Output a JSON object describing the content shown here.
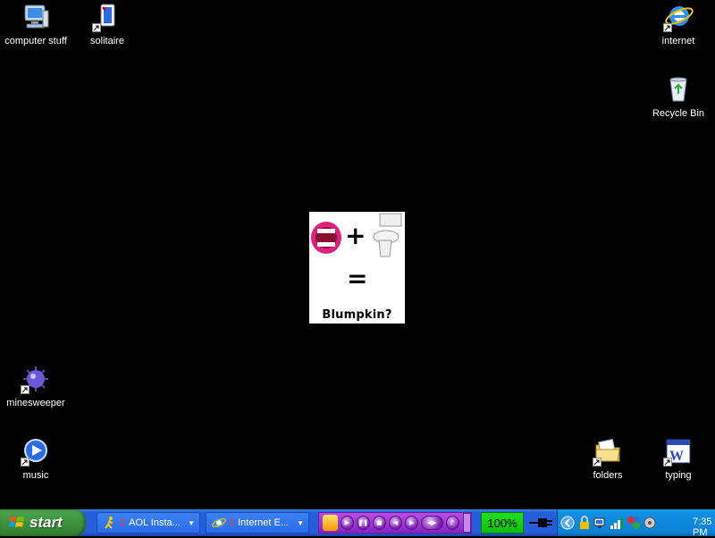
{
  "desktop": {
    "icons": {
      "computer": {
        "label": "computer stuff"
      },
      "solitaire": {
        "label": "solitaire"
      },
      "internet": {
        "label": "internet"
      },
      "recycle": {
        "label": "Recycle Bin"
      },
      "minesweeper": {
        "label": "minesweeper"
      },
      "music": {
        "label": "music"
      },
      "folders": {
        "label": "folders"
      },
      "typing": {
        "label": "typing"
      }
    },
    "wallpaper": {
      "caption": "Blumpkin?",
      "plus": "+",
      "equals": "="
    }
  },
  "taskbar": {
    "start_label": "start",
    "tasks": [
      {
        "count": "2",
        "label": "AOL Insta..."
      },
      {
        "count": "2",
        "label": "Internet E..."
      }
    ],
    "volume": "100%",
    "clock": "7:35 PM"
  }
}
